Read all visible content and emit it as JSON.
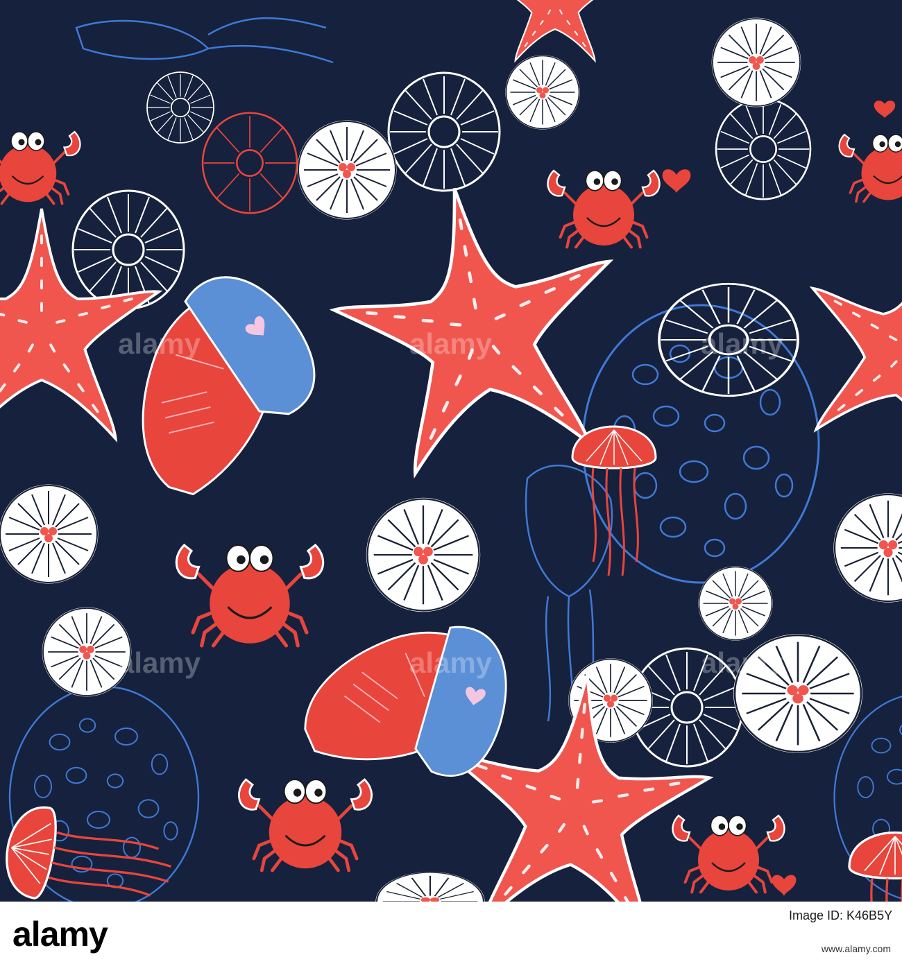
{
  "image": {
    "description_colors": {
      "background": "#16213d",
      "starfish": "#f0564e",
      "crab": "#e8453c",
      "shell_blue": "#5b8fd6",
      "line_white": "#ffffff",
      "line_blue": "#3f79d6"
    }
  },
  "watermark": {
    "text": "alamy"
  },
  "footer": {
    "logo": "alamy",
    "image_id": "Image ID: K46B5Y",
    "site": "www.alamy.com"
  }
}
